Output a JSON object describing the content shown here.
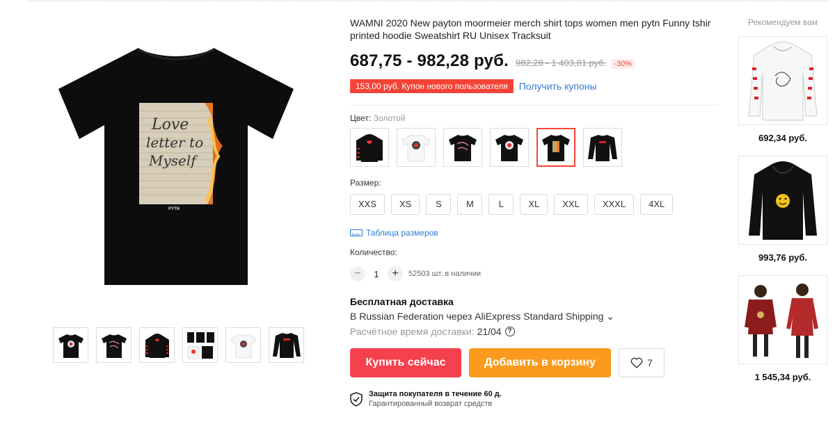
{
  "product": {
    "title": "WAMNI 2020 New payton moormeier merch shirt tops women men pytn Funny tshir\nprinted hoodie Sweatshirt RU Unisex Tracksuit",
    "price": "687,75 - 982,28 руб.",
    "old_price": "982,28 - 1 403,81 руб.",
    "discount": "-30%",
    "main_image": {
      "note_lines": [
        "Love",
        "letter to",
        "Myself"
      ],
      "brand": "PYTN"
    }
  },
  "coupon": {
    "text": "153,00 руб. Купон нового пользователя",
    "link": "Получить купоны"
  },
  "color": {
    "label": "Цвет:",
    "value": "Золотой",
    "options": [
      "black-hoodie",
      "white-tshirt",
      "black-tshirt-text",
      "black-tshirt-rose",
      "black-tshirt-letter",
      "black-longsleeve-pytn"
    ],
    "selected_index": 4
  },
  "size": {
    "label": "Размер:",
    "options": [
      "XXS",
      "XS",
      "S",
      "M",
      "L",
      "XL",
      "XXL",
      "XXXL",
      "4XL"
    ],
    "table_link": "Таблица размеров"
  },
  "quantity": {
    "label": "Количество:",
    "minus": "−",
    "value": "1",
    "plus": "+",
    "stock": "52503 шт. в наличии"
  },
  "shipping": {
    "title": "Бесплатная доставка",
    "line": "В Russian Federation через AliExpress Standard Shipping ⌄",
    "estimate_label": "Расчётное время доставки:",
    "estimate_date": "21/04",
    "help": "?"
  },
  "actions": {
    "buy": "Купить сейчас",
    "cart": "Добавить в корзину",
    "wishlist_count": "7"
  },
  "protection": {
    "title": "Защита покупателя в течение 60 д.",
    "subtitle": "Гарантированный возврат средств"
  },
  "recommendations": {
    "title": "Рекомендуем вам",
    "items": [
      {
        "price": "692,34 руб."
      },
      {
        "price": "993,76 руб."
      },
      {
        "price": "1 545,34 руб."
      }
    ]
  },
  "colors": {
    "accent_red": "#f44336",
    "buy_red": "#f5404d",
    "cart_orange": "#fa9b1f",
    "link_blue": "#2f7bd7"
  }
}
